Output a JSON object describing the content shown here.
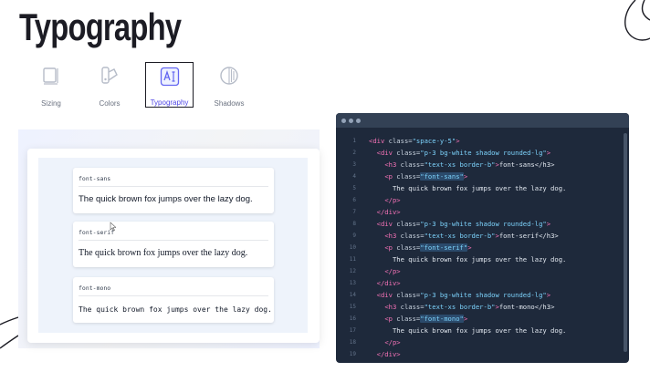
{
  "page": {
    "title": "Typography"
  },
  "tabs": [
    {
      "label": "Sizing",
      "icon": "sizing-icon"
    },
    {
      "label": "Colors",
      "icon": "colors-icon"
    },
    {
      "label": "Typography",
      "icon": "typography-icon",
      "active": true
    },
    {
      "label": "Shadows",
      "icon": "shadows-icon"
    }
  ],
  "preview": {
    "cards": [
      {
        "label": "font-sans",
        "text": "The quick brown fox jumps over the lazy dog."
      },
      {
        "label": "font-serif",
        "text": "The quick brown fox jumps over the lazy dog."
      },
      {
        "label": "font-mono",
        "text": "The quick brown fox jumps over the lazy dog."
      }
    ]
  },
  "code": {
    "line_numbers": [
      "1",
      "2",
      "3",
      "4",
      "5",
      "6",
      "7",
      "8",
      "9",
      "10",
      "11",
      "12",
      "13",
      "14",
      "15",
      "16",
      "17",
      "18",
      "19"
    ],
    "lines": [
      {
        "indent": "",
        "tag_open": "<div",
        "attr": " class=",
        "value": "\"space-y-5\"",
        "close": ">",
        "text": ""
      },
      {
        "indent": "  ",
        "tag_open": "<div",
        "attr": " class=",
        "value": "\"p-3 bg-white shadow rounded-lg\"",
        "close": ">",
        "text": ""
      },
      {
        "indent": "    ",
        "tag_open": "<h3",
        "attr": " class=",
        "value": "\"text-xs border-b\"",
        "close": ">",
        "text": "font-sans</h3>"
      },
      {
        "indent": "    ",
        "tag_open": "<p",
        "attr": " class=",
        "value": "\"font-sans\"",
        "close": ">",
        "text": "",
        "highlight": true
      },
      {
        "indent": "      ",
        "tag_open": "",
        "attr": "",
        "value": "",
        "close": "",
        "text": "The quick brown fox jumps over the lazy dog."
      },
      {
        "indent": "    ",
        "tag_open": "</p>",
        "attr": "",
        "value": "",
        "close": "",
        "text": ""
      },
      {
        "indent": "  ",
        "tag_open": "</div>",
        "attr": "",
        "value": "",
        "close": "",
        "text": ""
      },
      {
        "indent": "  ",
        "tag_open": "<div",
        "attr": " class=",
        "value": "\"p-3 bg-white shadow rounded-lg\"",
        "close": ">",
        "text": ""
      },
      {
        "indent": "    ",
        "tag_open": "<h3",
        "attr": " class=",
        "value": "\"text-xs border-b\"",
        "close": ">",
        "text": "font-serif</h3>"
      },
      {
        "indent": "    ",
        "tag_open": "<p",
        "attr": " class=",
        "value": "\"font-serif\"",
        "close": ">",
        "text": "",
        "highlight": true
      },
      {
        "indent": "      ",
        "tag_open": "",
        "attr": "",
        "value": "",
        "close": "",
        "text": "The quick brown fox jumps over the lazy dog."
      },
      {
        "indent": "    ",
        "tag_open": "</p>",
        "attr": "",
        "value": "",
        "close": "",
        "text": ""
      },
      {
        "indent": "  ",
        "tag_open": "</div>",
        "attr": "",
        "value": "",
        "close": "",
        "text": ""
      },
      {
        "indent": "  ",
        "tag_open": "<div",
        "attr": " class=",
        "value": "\"p-3 bg-white shadow rounded-lg\"",
        "close": ">",
        "text": ""
      },
      {
        "indent": "    ",
        "tag_open": "<h3",
        "attr": " class=",
        "value": "\"text-xs border-b\"",
        "close": ">",
        "text": "font-mono</h3>"
      },
      {
        "indent": "    ",
        "tag_open": "<p",
        "attr": " class=",
        "value": "\"font-mono\"",
        "close": ">",
        "text": "",
        "highlight": true
      },
      {
        "indent": "      ",
        "tag_open": "",
        "attr": "",
        "value": "",
        "close": "",
        "text": "The quick brown fox jumps over the lazy dog."
      },
      {
        "indent": "    ",
        "tag_open": "</p>",
        "attr": "",
        "value": "",
        "close": "",
        "text": ""
      },
      {
        "indent": "  ",
        "tag_open": "</div>",
        "attr": "",
        "value": "",
        "close": "",
        "text": ""
      }
    ]
  },
  "colors": {
    "accent": "#4f46e5",
    "code_bg": "#1e293b",
    "code_tag": "#f472b6",
    "code_string": "#7dd3fc"
  }
}
